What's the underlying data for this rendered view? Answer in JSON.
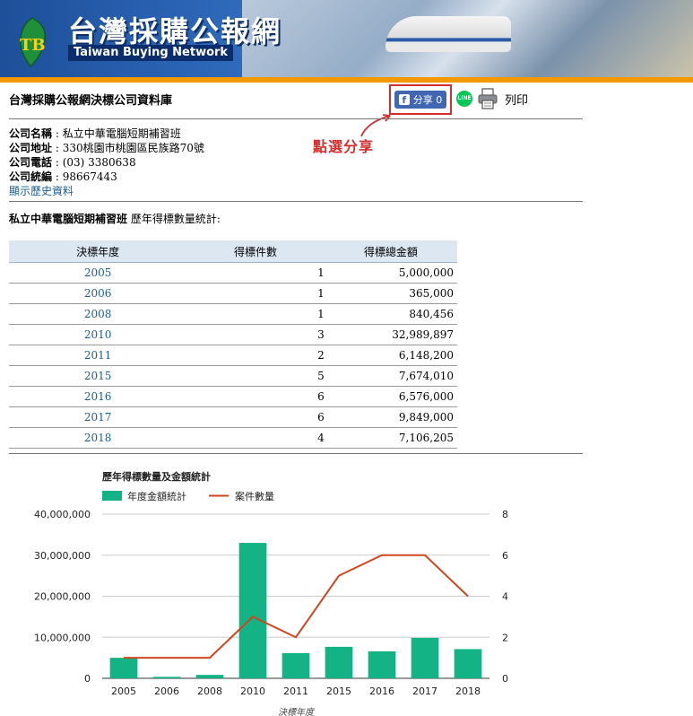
{
  "banner": {
    "logo_mark": "TB",
    "title": "台灣採購公報網",
    "subtitle": "Taiwan Buying Network"
  },
  "page_title": "台灣採購公報網決標公司資料庫",
  "share": {
    "fb_label": "分享 0",
    "line_label": "LINE",
    "print_label": "列印"
  },
  "annotation": "點選分享",
  "company": {
    "name_label": "公司名稱",
    "name": "私立中華電腦短期補習班",
    "address_label": "公司地址",
    "address": "330桃園市桃園區民族路70號",
    "phone_label": "公司電話",
    "phone": "(03) 3380638",
    "tax_label": "公司統編",
    "tax_id": "98667443",
    "history_link": "顯示歷史資料"
  },
  "stats": {
    "company_name": "私立中華電腦短期補習班",
    "title_suffix": "歷年得標數量統計:",
    "headers": [
      "決標年度",
      "得標件數",
      "得標總金額"
    ],
    "rows": [
      {
        "year": "2005",
        "count": "1",
        "amount": "5,000,000"
      },
      {
        "year": "2006",
        "count": "1",
        "amount": "365,000"
      },
      {
        "year": "2008",
        "count": "1",
        "amount": "840,456"
      },
      {
        "year": "2010",
        "count": "3",
        "amount": "32,989,897"
      },
      {
        "year": "2011",
        "count": "2",
        "amount": "6,148,200"
      },
      {
        "year": "2015",
        "count": "5",
        "amount": "7,674,010"
      },
      {
        "year": "2016",
        "count": "6",
        "amount": "6,576,000"
      },
      {
        "year": "2017",
        "count": "6",
        "amount": "9,849,000"
      },
      {
        "year": "2018",
        "count": "4",
        "amount": "7,106,205"
      }
    ]
  },
  "colors": {
    "bar": "#14b386",
    "line": "#d0461f",
    "annotation": "#d32f2f",
    "link": "#1a5e91",
    "header_bg": "#dce7f2",
    "accent_stripe": "#f39800"
  },
  "chart_data": {
    "type": "bar",
    "title": "歷年得標數量及金額統計",
    "xlabel": "決標年度",
    "categories": [
      "2005",
      "2006",
      "2008",
      "2010",
      "2011",
      "2015",
      "2016",
      "2017",
      "2018"
    ],
    "series": [
      {
        "name": "年度金額統計",
        "type": "bar",
        "axis": "left",
        "values": [
          5000000,
          365000,
          840456,
          32989897,
          6148200,
          7674010,
          6576000,
          9849000,
          7106205
        ]
      },
      {
        "name": "案件數量",
        "type": "line",
        "axis": "right",
        "values": [
          1,
          1,
          1,
          3,
          2,
          5,
          6,
          6,
          4
        ]
      }
    ],
    "ylim_left": [
      0,
      40000000
    ],
    "yticks_left": [
      "0",
      "10,000,000",
      "20,000,000",
      "30,000,000",
      "40,000,000"
    ],
    "ylim_right": [
      0,
      8
    ],
    "yticks_right": [
      "0",
      "2",
      "4",
      "6",
      "8"
    ],
    "grid": true,
    "legend": "top-left"
  }
}
